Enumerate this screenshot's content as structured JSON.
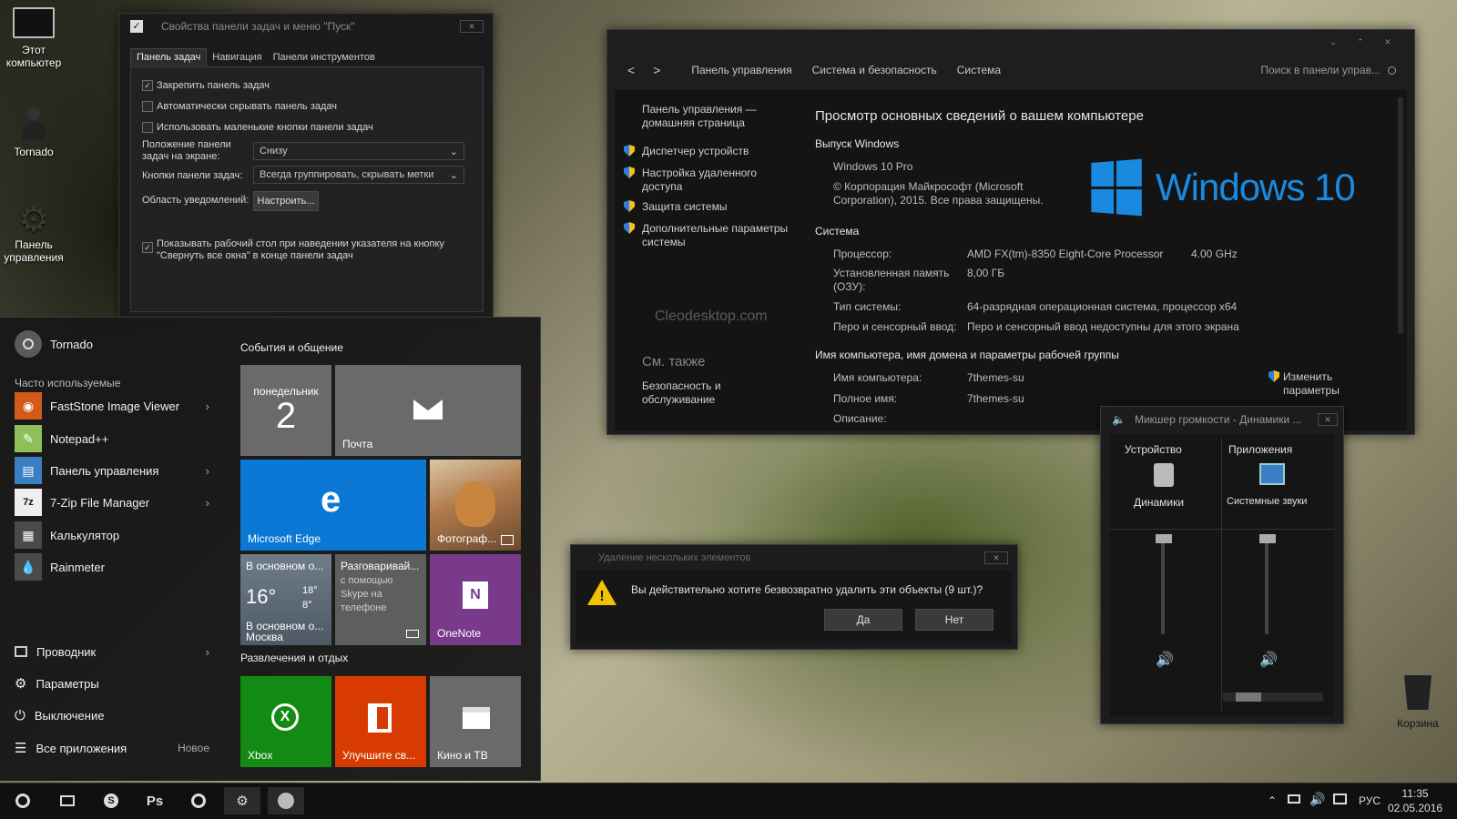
{
  "desktop": {
    "icons": [
      {
        "label": "Этот компьютер"
      },
      {
        "label": "Tornado"
      },
      {
        "label": "Панель управления"
      },
      {
        "label": "Корзина"
      }
    ],
    "watermark": "Cleodesktop.com"
  },
  "taskbar_props": {
    "title": "Свойства панели задач и меню \"Пуск\"",
    "tabs": [
      "Панель задач",
      "Навигация",
      "Панели инструментов"
    ],
    "checks": [
      {
        "label": "Закрепить панель задач",
        "checked": true
      },
      {
        "label": "Автоматически скрывать панель задач",
        "checked": false
      },
      {
        "label": "Использовать маленькие кнопки панели задач",
        "checked": false
      }
    ],
    "position_label": "Положение панели задач на экране:",
    "position_value": "Снизу",
    "buttons_label": "Кнопки панели задач:",
    "buttons_value": "Всегда группировать, скрывать метки",
    "notify_label": "Область уведомлений:",
    "notify_button": "Настроить...",
    "peek_label": "Показывать рабочий стол при наведении указателя на кнопку \"Свернуть все окна\" в конце панели задач",
    "peek_checked": true
  },
  "system_window": {
    "breadcrumb": [
      "Панель управления",
      "Система и безопасность",
      "Система"
    ],
    "nav_back": "<",
    "nav_forward": ">",
    "search_placeholder": "Поиск в панели управ...",
    "home_link": "Панель управления — домашняя страница",
    "side_links": [
      "Диспетчер устройств",
      "Настройка удаленного доступа",
      "Защита системы",
      "Дополнительные параметры системы"
    ],
    "see_also": "См. также",
    "see_also_link": "Безопасность и обслуживание",
    "heading": "Просмотр основных сведений о вашем компьютере",
    "edition_header": "Выпуск Windows",
    "edition": "Windows 10 Pro",
    "copyright": "© Корпорация Майкрософт (Microsoft Corporation), 2015. Все права защищены.",
    "logo_text": "Windows 10",
    "system_header": "Система",
    "processor_label": "Процессор:",
    "processor_value": "AMD FX(tm)-8350 Eight-Core Processor",
    "processor_speed": "4.00 GHz",
    "ram_label": "Установленная память (ОЗУ):",
    "ram_value": "8,00 ГБ",
    "type_label": "Тип системы:",
    "type_value": "64-разрядная операционная система, процессор x64",
    "pen_label": "Перо и сенсорный ввод:",
    "pen_value": "Перо и сенсорный ввод недоступны для этого экрана",
    "name_header": "Имя компьютера, имя домена и параметры рабочей группы",
    "comp_name_label": "Имя компьютера:",
    "comp_name_value": "7themes-su",
    "full_name_label": "Полное имя:",
    "full_name_value": "7themes-su",
    "desc_label": "Описание:",
    "change_link": "Изменить параметры"
  },
  "start_menu": {
    "user": "Tornado",
    "most_used_header": "Часто используемые",
    "apps": [
      {
        "label": "FastStone Image Viewer",
        "arrow": true
      },
      {
        "label": "Notepad++",
        "arrow": false
      },
      {
        "label": "Панель управления",
        "arrow": true
      },
      {
        "label": "7-Zip File Manager",
        "arrow": true
      },
      {
        "label": "Калькулятор",
        "arrow": false
      },
      {
        "label": "Rainmeter",
        "arrow": false
      }
    ],
    "bottom": [
      {
        "label": "Проводник",
        "arrow": true
      },
      {
        "label": "Параметры",
        "arrow": false
      },
      {
        "label": "Выключение",
        "arrow": false
      },
      {
        "label": "Все приложения",
        "badge": "Новое"
      }
    ],
    "group1": "События и общение",
    "group2": "Развлечения и отдых",
    "tiles": {
      "calendar_day": "понедельник",
      "calendar_date": "2",
      "mail": "Почта",
      "edge": "Microsoft Edge",
      "photos": "Фотограф...",
      "weather_top": "В основном о...",
      "weather_temp": "16°",
      "weather_hi": "18°",
      "weather_lo": "8°",
      "weather_bottom": "В основном о...",
      "weather_city": "Москва",
      "skype_title": "Разговаривай...",
      "skype_text": "с помощью Skype на телефоне",
      "onenote": "OneNote",
      "xbox": "Xbox",
      "office": "Улучшите св...",
      "movies": "Кино и ТВ"
    }
  },
  "delete_dialog": {
    "title": "Удаление нескольких элементов",
    "message": "Вы действительно хотите безвозвратно удалить эти объекты (9 шт.)?",
    "yes": "Да",
    "no": "Нет"
  },
  "mixer": {
    "title": "Микшер громкости - Динамики ...",
    "device_header": "Устройство",
    "apps_header": "Приложения",
    "device_name": "Динамики",
    "app_name": "Системные звуки",
    "device_level": 1.0,
    "app_level": 1.0
  },
  "taskbar": {
    "lang": "РУС",
    "time": "11:35",
    "date": "02.05.2016",
    "ps_label": "Ps"
  },
  "colors": {
    "edge_tile": "#0a78d4",
    "onenote_tile": "#7a3a8c",
    "xbox_tile": "#138a13",
    "office_tile": "#d83b01",
    "win_logo": "#1a8ae0",
    "accent_text": "#4aa3ff"
  }
}
